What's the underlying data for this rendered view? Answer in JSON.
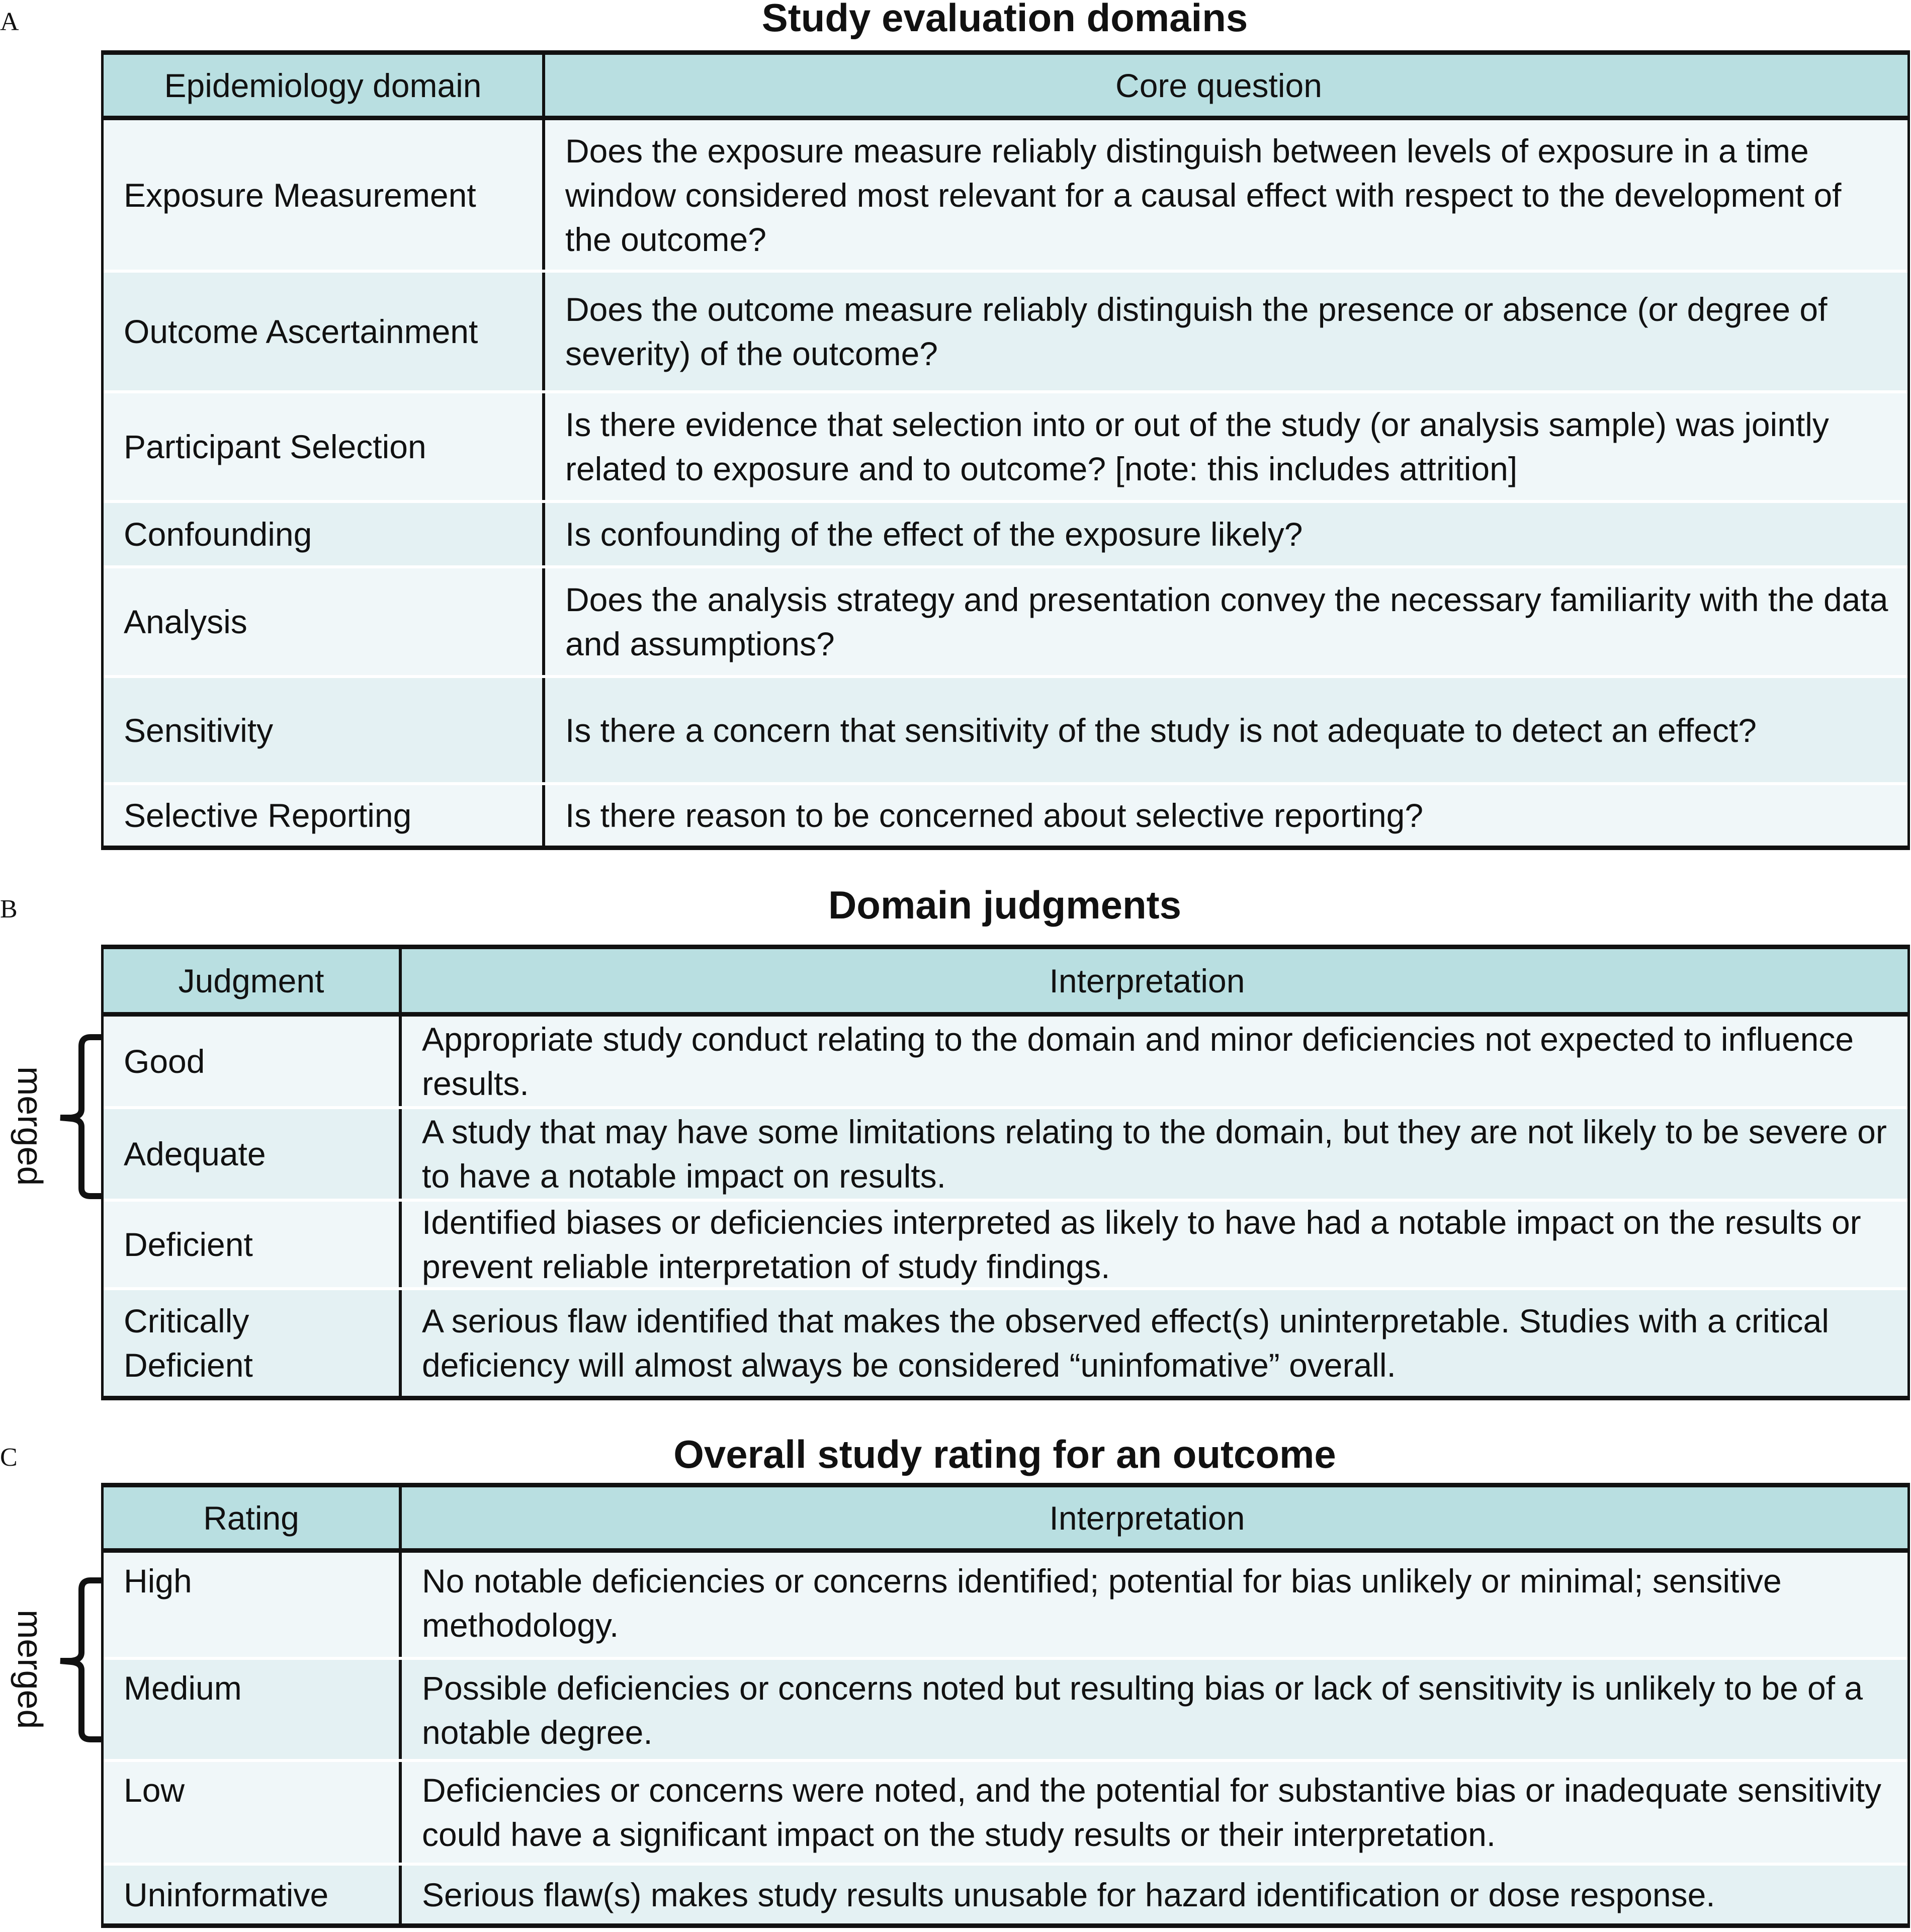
{
  "panels": {
    "A": {
      "label": "A",
      "title": "Study evaluation domains",
      "headers": [
        "Epidemiology domain",
        "Core question"
      ],
      "rows": [
        {
          "domain": "Exposure Measurement",
          "question": "Does the exposure measure reliably distinguish between levels of exposure in a time window considered most relevant for a causal effect with respect to the development of the outcome?"
        },
        {
          "domain": "Outcome Ascertainment",
          "question": "Does the outcome measure reliably distinguish the presence or absence (or degree of severity) of the outcome?"
        },
        {
          "domain": "Participant Selection",
          "question": "Is there evidence that selection into or out of the study (or analysis sample) was jointly related to exposure and to outcome? [note: this includes attrition]"
        },
        {
          "domain": "Confounding",
          "question": "Is confounding of the effect of the exposure likely?"
        },
        {
          "domain": "Analysis",
          "question": "Does the analysis strategy and presentation convey the necessary familiarity with the data and assumptions?"
        },
        {
          "domain": "Sensitivity",
          "question": "Is there a concern that sensitivity of the study is not adequate to detect an effect?"
        },
        {
          "domain": "Selective Reporting",
          "question": "Is there reason to be concerned about selective reporting?"
        }
      ]
    },
    "B": {
      "label": "B",
      "title": "Domain judgments",
      "headers": [
        "Judgment",
        "Interpretation"
      ],
      "merged_label": "merged",
      "rows": [
        {
          "judgment": "Good",
          "interpretation": "Appropriate study conduct relating to the domain and minor deficiencies not expected to influence results."
        },
        {
          "judgment": "Adequate",
          "interpretation": "A study that may have some limitations relating to the domain, but they are not likely to be severe or to have a notable impact on results."
        },
        {
          "judgment": "Deficient",
          "interpretation": "Identified biases or deficiencies interpreted as likely to have had a notable impact on the results or prevent reliable interpretation of study findings."
        },
        {
          "judgment": "Critically Deficient",
          "interpretation": "A serious flaw identified that makes the observed effect(s) uninterpretable. Studies with a critical deficiency will almost always be considered “uninfomative” overall."
        }
      ]
    },
    "C": {
      "label": "C",
      "title": "Overall study rating for an outcome",
      "headers": [
        "Rating",
        "Interpretation"
      ],
      "merged_label": "merged",
      "rows": [
        {
          "rating": "High",
          "interpretation": "No notable deficiencies or concerns identified; potential for bias unlikely or minimal; sensitive methodology."
        },
        {
          "rating": "Medium",
          "interpretation": "Possible deficiencies or concerns noted but resulting bias or lack of sensitivity is unlikely to be of a notable degree."
        },
        {
          "rating": "Low",
          "interpretation": "Deficiencies or concerns were noted, and the potential for substantive bias or inadequate sensitivity could have a significant impact on the study results or their interpretation."
        },
        {
          "rating": "Uninformative",
          "interpretation": "Serious flaw(s) makes study results unusable for hazard identification or dose response."
        }
      ]
    }
  },
  "colors": {
    "header_bg": "#b9dfe1",
    "row_light": "#f0f7f9",
    "row_alt": "#e4f1f3",
    "border": "#111111"
  }
}
